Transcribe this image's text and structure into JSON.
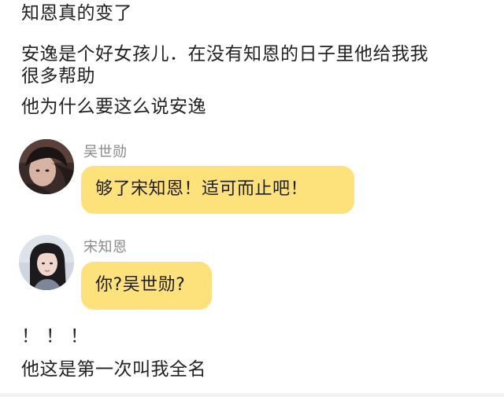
{
  "story": {
    "line1": "知恩真的变了",
    "line2": "安逸是个好女孩儿．在没有知恩的日子里他给我我\n很多帮助",
    "line3": "他为什么要这么说安逸",
    "line4": "！！！",
    "line5": "他这是第一次叫我全名"
  },
  "chat": [
    {
      "speaker": "吴世勋",
      "message": "够了宋知恩！适可而止吧！",
      "avatar_icon": "person-dark-hair-avatar"
    },
    {
      "speaker": "宋知恩",
      "message": "你?吴世勋?",
      "avatar_icon": "person-long-hair-avatar"
    }
  ],
  "colors": {
    "bubble": "#fde17b",
    "speaker_name": "#8a8a8a",
    "text": "#222222"
  }
}
